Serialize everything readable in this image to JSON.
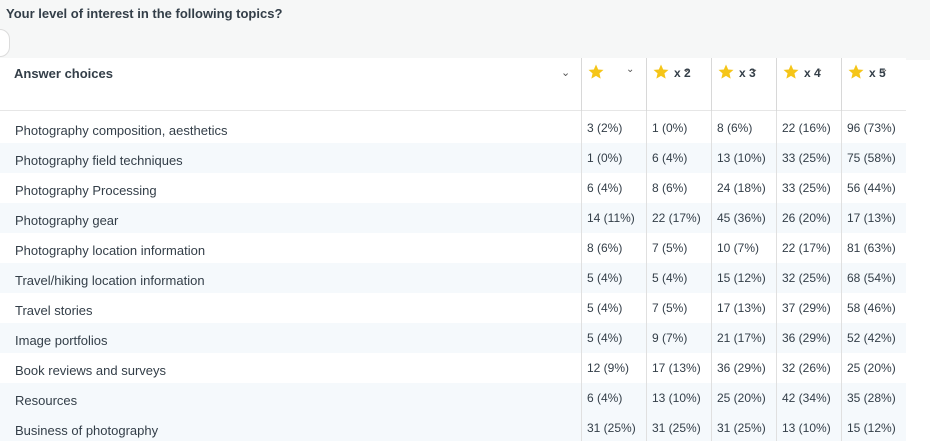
{
  "question": {
    "title": "Your level of interest in the following topics?"
  },
  "table": {
    "answer_header": "Answer choices",
    "sort_icon": "chevron-down-icon",
    "star_color": "#f5c518",
    "columns": [
      {
        "multiplier": "",
        "icon": "star-icon"
      },
      {
        "multiplier": "x 2",
        "icon": "star-icon"
      },
      {
        "multiplier": "x 3",
        "icon": "star-icon"
      },
      {
        "multiplier": "x 4",
        "icon": "star-icon"
      },
      {
        "multiplier": "x 5",
        "icon": "star-icon"
      }
    ],
    "rows": [
      {
        "label": "Photography composition, aesthetics",
        "values": [
          "3 (2%)",
          "1 (0%)",
          "8 (6%)",
          "22 (16%)",
          "96 (73%)"
        ]
      },
      {
        "label": "Photography field techniques",
        "values": [
          "1 (0%)",
          "6 (4%)",
          "13 (10%)",
          "33 (25%)",
          "75 (58%)"
        ]
      },
      {
        "label": "Photography Processing",
        "values": [
          "6 (4%)",
          "8 (6%)",
          "24 (18%)",
          "33 (25%)",
          "56 (44%)"
        ]
      },
      {
        "label": "Photography gear",
        "values": [
          "14 (11%)",
          "22 (17%)",
          "45 (36%)",
          "26 (20%)",
          "17 (13%)"
        ]
      },
      {
        "label": "Photography location information",
        "values": [
          "8 (6%)",
          "7 (5%)",
          "10 (7%)",
          "22 (17%)",
          "81 (63%)"
        ]
      },
      {
        "label": "Travel/hiking location information",
        "values": [
          "5 (4%)",
          "5 (4%)",
          "15 (12%)",
          "32 (25%)",
          "68 (54%)"
        ]
      },
      {
        "label": "Travel stories",
        "values": [
          "5 (4%)",
          "7 (5%)",
          "17 (13%)",
          "37 (29%)",
          "58 (46%)"
        ]
      },
      {
        "label": "Image portfolios",
        "values": [
          "5 (4%)",
          "9 (7%)",
          "21 (17%)",
          "36 (29%)",
          "52 (42%)"
        ]
      },
      {
        "label": "Book reviews and surveys",
        "values": [
          "12 (9%)",
          "17 (13%)",
          "36 (29%)",
          "32 (26%)",
          "25 (20%)"
        ]
      },
      {
        "label": "Resources",
        "values": [
          "6 (4%)",
          "13 (10%)",
          "25 (20%)",
          "42 (34%)",
          "35 (28%)"
        ]
      },
      {
        "label": "Business of photography",
        "values": [
          "31 (25%)",
          "31 (25%)",
          "31 (25%)",
          "13 (10%)",
          "15 (12%)"
        ]
      }
    ]
  }
}
